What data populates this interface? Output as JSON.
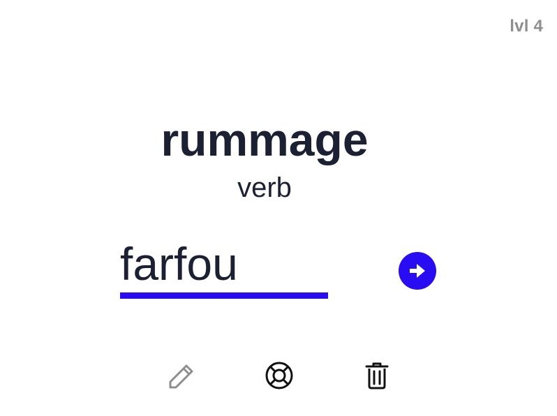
{
  "level": {
    "label": "lvl 4"
  },
  "card": {
    "word": "rummage",
    "part_of_speech": "verb"
  },
  "answer": {
    "value": "farfou",
    "placeholder": ""
  },
  "icons": {
    "submit": "arrow-right-circle-icon",
    "edit": "pencil-icon",
    "help": "lifebuoy-icon",
    "delete": "trash-icon"
  },
  "colors": {
    "accent": "#2a0cf2",
    "text": "#1b2033",
    "muted": "#8e8e8e"
  }
}
